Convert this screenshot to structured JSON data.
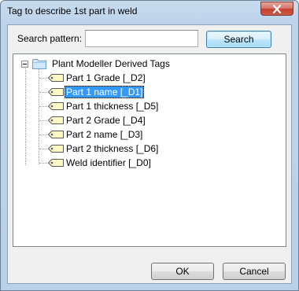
{
  "window": {
    "title": "Tag to describe 1st part in weld"
  },
  "search": {
    "label": "Search pattern:",
    "value": "",
    "placeholder": "",
    "button_label": "Search"
  },
  "tree": {
    "root": {
      "label": "Plant Modeller Derived Tags",
      "icon": "folder-icon",
      "expanded": true
    },
    "items": [
      {
        "label": "Part 1 Grade [_D2]",
        "icon": "tag-icon",
        "selected": false
      },
      {
        "label": "Part 1 name [_D1]",
        "icon": "tag-icon",
        "selected": true
      },
      {
        "label": "Part 1 thickness [_D5]",
        "icon": "tag-icon",
        "selected": false
      },
      {
        "label": "Part 2 Grade [_D4]",
        "icon": "tag-icon",
        "selected": false
      },
      {
        "label": "Part 2 name [_D3]",
        "icon": "tag-icon",
        "selected": false
      },
      {
        "label": "Part 2 thickness [_D6]",
        "icon": "tag-icon",
        "selected": false
      },
      {
        "label": "Weld identifier [_D0]",
        "icon": "tag-icon",
        "selected": false
      }
    ]
  },
  "buttons": {
    "ok_label": "OK",
    "cancel_label": "Cancel"
  },
  "colors": {
    "selection": "#3399ff",
    "frame": "#b9d1e9",
    "close_button": "#c2402d"
  }
}
